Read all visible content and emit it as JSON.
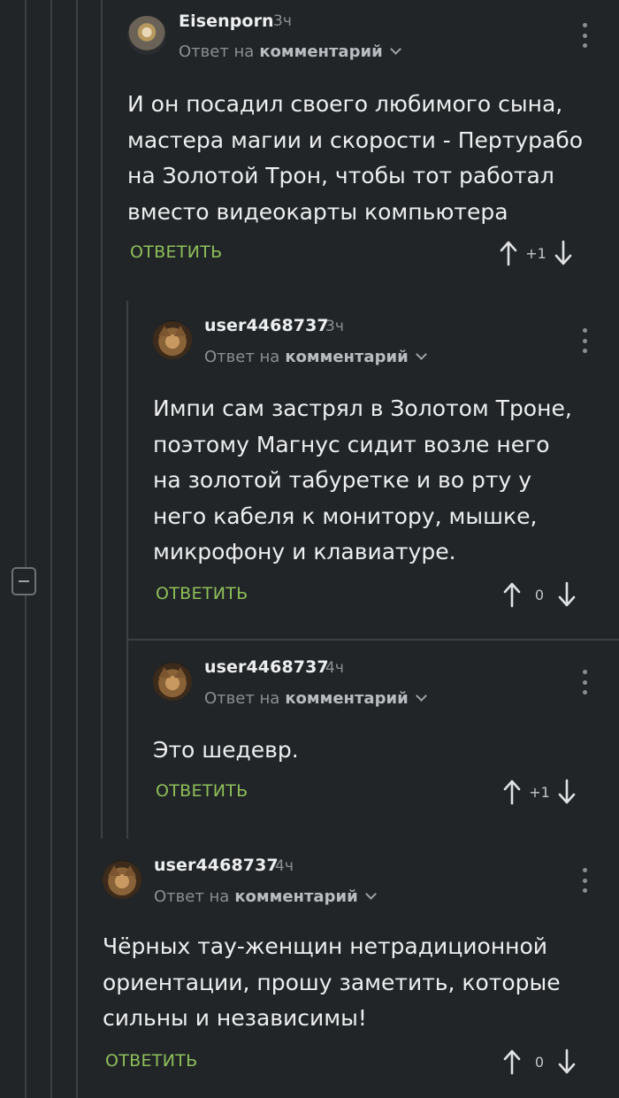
{
  "comments": [
    {
      "author": "Eisenporn",
      "time": "3ч",
      "reply_prefix": "Ответ на",
      "reply_target": "комментарий",
      "lines": [
        "И он посадил своего любимого сына,",
        "мастера магии и скорости - Пертурабо",
        "на Золотой Трон, чтобы тот работал",
        "вместо видеокарты компьютера"
      ],
      "reply_label": "ОТВЕТИТЬ",
      "score": "+1"
    },
    {
      "author": "user4468737",
      "time": "3ч",
      "reply_prefix": "Ответ на",
      "reply_target": "комментарий",
      "lines": [
        "Импи сам застрял в Золотом Троне,",
        "поэтому Магнус сидит возле него",
        "на золотой табуретке и во рту у",
        "него кабеля к монитору, мышке,",
        "микрофону и клавиатуре."
      ],
      "reply_label": "ОТВЕТИТЬ",
      "score": "0"
    },
    {
      "author": "user4468737",
      "time": "4ч",
      "reply_prefix": "Ответ на",
      "reply_target": "комментарий",
      "lines": [
        "Это шедевр."
      ],
      "reply_label": "ОТВЕТИТЬ",
      "score": "+1"
    },
    {
      "author": "user4468737",
      "time": "4ч",
      "reply_prefix": "Ответ на",
      "reply_target": "комментарий",
      "lines": [
        "Чёрных тау-женщин нетрадиционной",
        "ориентации, прошу заметить, которые",
        "сильны и независимы!"
      ],
      "reply_label": "ОТВЕТИТЬ",
      "score": "0"
    }
  ],
  "icons": {
    "collapse": "collapse-thread-icon",
    "menu": "more-options-icon",
    "upvote": "arrow-up-icon",
    "downvote": "arrow-down-icon",
    "dropdown": "chevron-down-icon"
  },
  "colors": {
    "background": "#222527",
    "reply_accent": "#8dbf5a",
    "muted": "#8b8f94",
    "thread_line": "#3c4044"
  }
}
